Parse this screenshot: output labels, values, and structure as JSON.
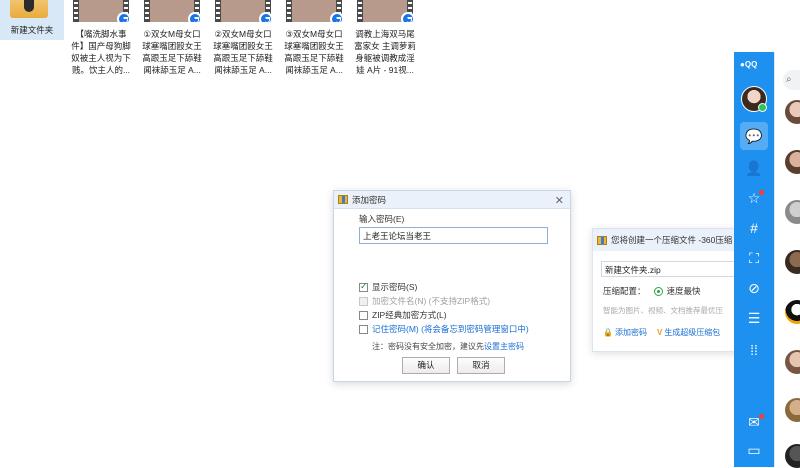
{
  "desktop": {
    "folder_label": "新建文件夹",
    "files": [
      {
        "line1": "【嘴洗脚水事",
        "line2": "件】国产母狗脚",
        "line3": "奴被主人视为下",
        "line4": "贱。饮主人的..."
      },
      {
        "line1": "①双女M母女口",
        "line2": "球塞嘴团殴女王",
        "line3": "高跟玉足下舔鞋",
        "line4": "闻袜舔玉足 A..."
      },
      {
        "line1": "②双女M母女口",
        "line2": "球塞嘴团殴女王",
        "line3": "高跟玉足下舔鞋",
        "line4": "闻袜舔玉足 A..."
      },
      {
        "line1": "③双女M母女口",
        "line2": "球塞嘴团殴女王",
        "line3": "高跟玉足下舔鞋",
        "line4": "闻袜舔玉足 A..."
      },
      {
        "line1": "调教上海双马尾",
        "line2": "富家女 主调萝莉",
        "line3": "身躯被调教成淫",
        "line4": "娃 A片 - 91视..."
      }
    ]
  },
  "password_dialog": {
    "title": "添加密码",
    "input_label": "输入密码(E)",
    "password_value": "上老王论坛当老王",
    "show_password": "显示密码(S)",
    "encrypt_filename": "加密文件名(N) (不支持ZIP格式)",
    "zip_classic": "ZIP经典加密方式(L)",
    "remember_password": "记住密码(M) (将会备忘到密码管理窗口中)",
    "note_prefix": "注：密码没有安全加密，建议先",
    "note_link": "设置主密码",
    "ok_label": "确认",
    "cancel_label": "取消"
  },
  "zip_panel": {
    "title": "您将创建一个压缩文件 -360压缩",
    "filename": "新建文件夹.zip",
    "config_label": "压缩配置：",
    "option_fast": "速度最快",
    "hint": "智能为图片、视频、文档推荐最优压",
    "add_password": "添加密码",
    "super_zip": "生成超级压缩包"
  },
  "qq_sidebar": {
    "logo": "QQ",
    "icons": [
      "message-icon",
      "contacts-icon",
      "star-icon",
      "hashtag-icon",
      "map-icon",
      "link-icon",
      "list-icon",
      "apps-icon",
      "mail-icon",
      "folder-icon"
    ]
  },
  "colors": {
    "qq_blue": "#1e90f0",
    "link_blue": "#1a6fd6",
    "check_green": "#2aa34a",
    "dialog_title_bg": "#eaf1fa"
  }
}
